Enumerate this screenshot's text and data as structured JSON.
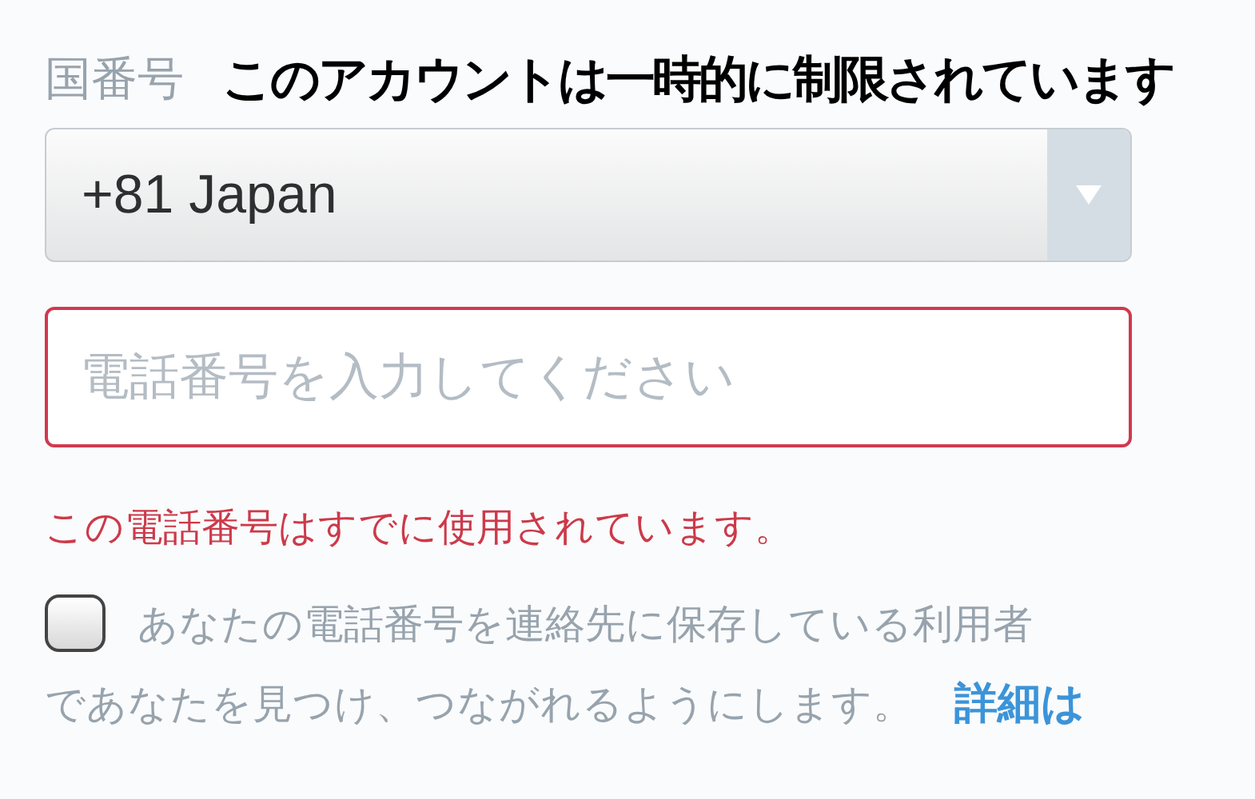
{
  "caption": "このアカウントは一時的に制限されています",
  "country_code": {
    "label": "国番号",
    "value": "+81 Japan"
  },
  "phone_field": {
    "placeholder": "電話番号を入力してください",
    "error": true
  },
  "error_message": "この電話番号はすでに使用されています。",
  "contacts_option": {
    "checked": false,
    "lines": [
      "あなたの電話番号を連絡先に保存している利用者",
      "であなたを見つけ、つながれるようにします。"
    ],
    "link": "詳細は"
  }
}
